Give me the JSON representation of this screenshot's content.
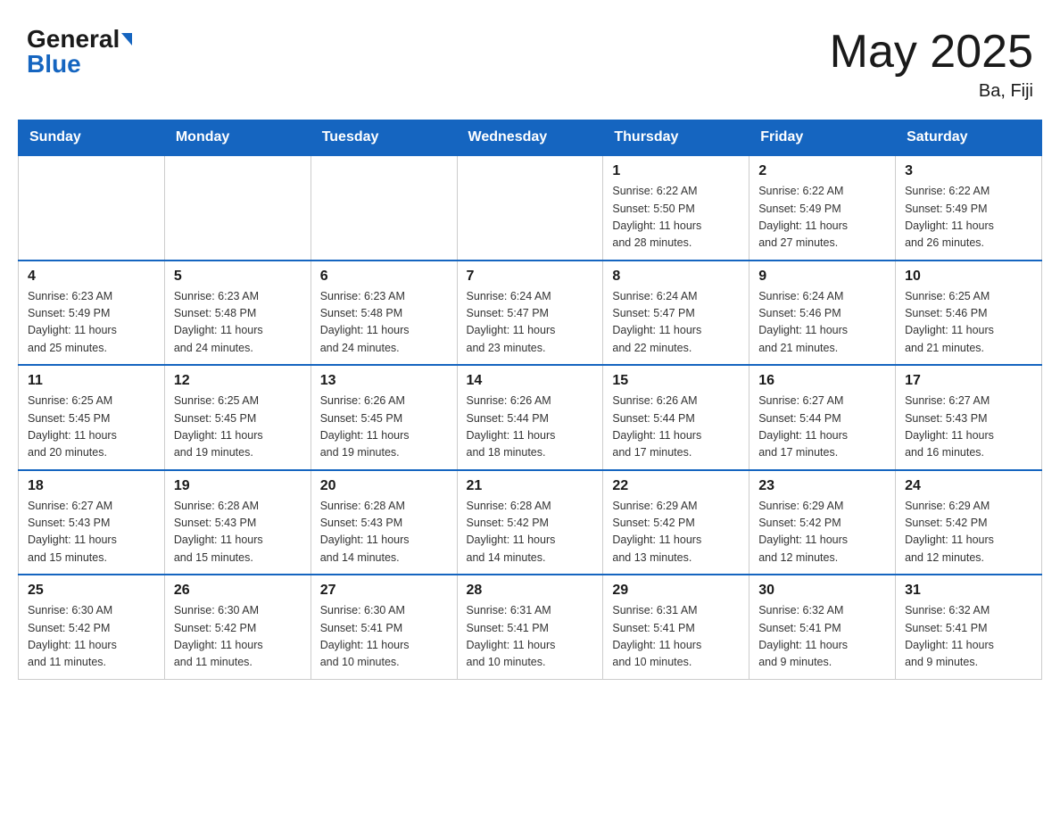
{
  "header": {
    "logo_general": "General",
    "logo_blue": "Blue",
    "month_title": "May 2025",
    "location": "Ba, Fiji"
  },
  "weekdays": [
    "Sunday",
    "Monday",
    "Tuesday",
    "Wednesday",
    "Thursday",
    "Friday",
    "Saturday"
  ],
  "weeks": [
    [
      {
        "day": "",
        "info": ""
      },
      {
        "day": "",
        "info": ""
      },
      {
        "day": "",
        "info": ""
      },
      {
        "day": "",
        "info": ""
      },
      {
        "day": "1",
        "info": "Sunrise: 6:22 AM\nSunset: 5:50 PM\nDaylight: 11 hours\nand 28 minutes."
      },
      {
        "day": "2",
        "info": "Sunrise: 6:22 AM\nSunset: 5:49 PM\nDaylight: 11 hours\nand 27 minutes."
      },
      {
        "day": "3",
        "info": "Sunrise: 6:22 AM\nSunset: 5:49 PM\nDaylight: 11 hours\nand 26 minutes."
      }
    ],
    [
      {
        "day": "4",
        "info": "Sunrise: 6:23 AM\nSunset: 5:49 PM\nDaylight: 11 hours\nand 25 minutes."
      },
      {
        "day": "5",
        "info": "Sunrise: 6:23 AM\nSunset: 5:48 PM\nDaylight: 11 hours\nand 24 minutes."
      },
      {
        "day": "6",
        "info": "Sunrise: 6:23 AM\nSunset: 5:48 PM\nDaylight: 11 hours\nand 24 minutes."
      },
      {
        "day": "7",
        "info": "Sunrise: 6:24 AM\nSunset: 5:47 PM\nDaylight: 11 hours\nand 23 minutes."
      },
      {
        "day": "8",
        "info": "Sunrise: 6:24 AM\nSunset: 5:47 PM\nDaylight: 11 hours\nand 22 minutes."
      },
      {
        "day": "9",
        "info": "Sunrise: 6:24 AM\nSunset: 5:46 PM\nDaylight: 11 hours\nand 21 minutes."
      },
      {
        "day": "10",
        "info": "Sunrise: 6:25 AM\nSunset: 5:46 PM\nDaylight: 11 hours\nand 21 minutes."
      }
    ],
    [
      {
        "day": "11",
        "info": "Sunrise: 6:25 AM\nSunset: 5:45 PM\nDaylight: 11 hours\nand 20 minutes."
      },
      {
        "day": "12",
        "info": "Sunrise: 6:25 AM\nSunset: 5:45 PM\nDaylight: 11 hours\nand 19 minutes."
      },
      {
        "day": "13",
        "info": "Sunrise: 6:26 AM\nSunset: 5:45 PM\nDaylight: 11 hours\nand 19 minutes."
      },
      {
        "day": "14",
        "info": "Sunrise: 6:26 AM\nSunset: 5:44 PM\nDaylight: 11 hours\nand 18 minutes."
      },
      {
        "day": "15",
        "info": "Sunrise: 6:26 AM\nSunset: 5:44 PM\nDaylight: 11 hours\nand 17 minutes."
      },
      {
        "day": "16",
        "info": "Sunrise: 6:27 AM\nSunset: 5:44 PM\nDaylight: 11 hours\nand 17 minutes."
      },
      {
        "day": "17",
        "info": "Sunrise: 6:27 AM\nSunset: 5:43 PM\nDaylight: 11 hours\nand 16 minutes."
      }
    ],
    [
      {
        "day": "18",
        "info": "Sunrise: 6:27 AM\nSunset: 5:43 PM\nDaylight: 11 hours\nand 15 minutes."
      },
      {
        "day": "19",
        "info": "Sunrise: 6:28 AM\nSunset: 5:43 PM\nDaylight: 11 hours\nand 15 minutes."
      },
      {
        "day": "20",
        "info": "Sunrise: 6:28 AM\nSunset: 5:43 PM\nDaylight: 11 hours\nand 14 minutes."
      },
      {
        "day": "21",
        "info": "Sunrise: 6:28 AM\nSunset: 5:42 PM\nDaylight: 11 hours\nand 14 minutes."
      },
      {
        "day": "22",
        "info": "Sunrise: 6:29 AM\nSunset: 5:42 PM\nDaylight: 11 hours\nand 13 minutes."
      },
      {
        "day": "23",
        "info": "Sunrise: 6:29 AM\nSunset: 5:42 PM\nDaylight: 11 hours\nand 12 minutes."
      },
      {
        "day": "24",
        "info": "Sunrise: 6:29 AM\nSunset: 5:42 PM\nDaylight: 11 hours\nand 12 minutes."
      }
    ],
    [
      {
        "day": "25",
        "info": "Sunrise: 6:30 AM\nSunset: 5:42 PM\nDaylight: 11 hours\nand 11 minutes."
      },
      {
        "day": "26",
        "info": "Sunrise: 6:30 AM\nSunset: 5:42 PM\nDaylight: 11 hours\nand 11 minutes."
      },
      {
        "day": "27",
        "info": "Sunrise: 6:30 AM\nSunset: 5:41 PM\nDaylight: 11 hours\nand 10 minutes."
      },
      {
        "day": "28",
        "info": "Sunrise: 6:31 AM\nSunset: 5:41 PM\nDaylight: 11 hours\nand 10 minutes."
      },
      {
        "day": "29",
        "info": "Sunrise: 6:31 AM\nSunset: 5:41 PM\nDaylight: 11 hours\nand 10 minutes."
      },
      {
        "day": "30",
        "info": "Sunrise: 6:32 AM\nSunset: 5:41 PM\nDaylight: 11 hours\nand 9 minutes."
      },
      {
        "day": "31",
        "info": "Sunrise: 6:32 AM\nSunset: 5:41 PM\nDaylight: 11 hours\nand 9 minutes."
      }
    ]
  ]
}
